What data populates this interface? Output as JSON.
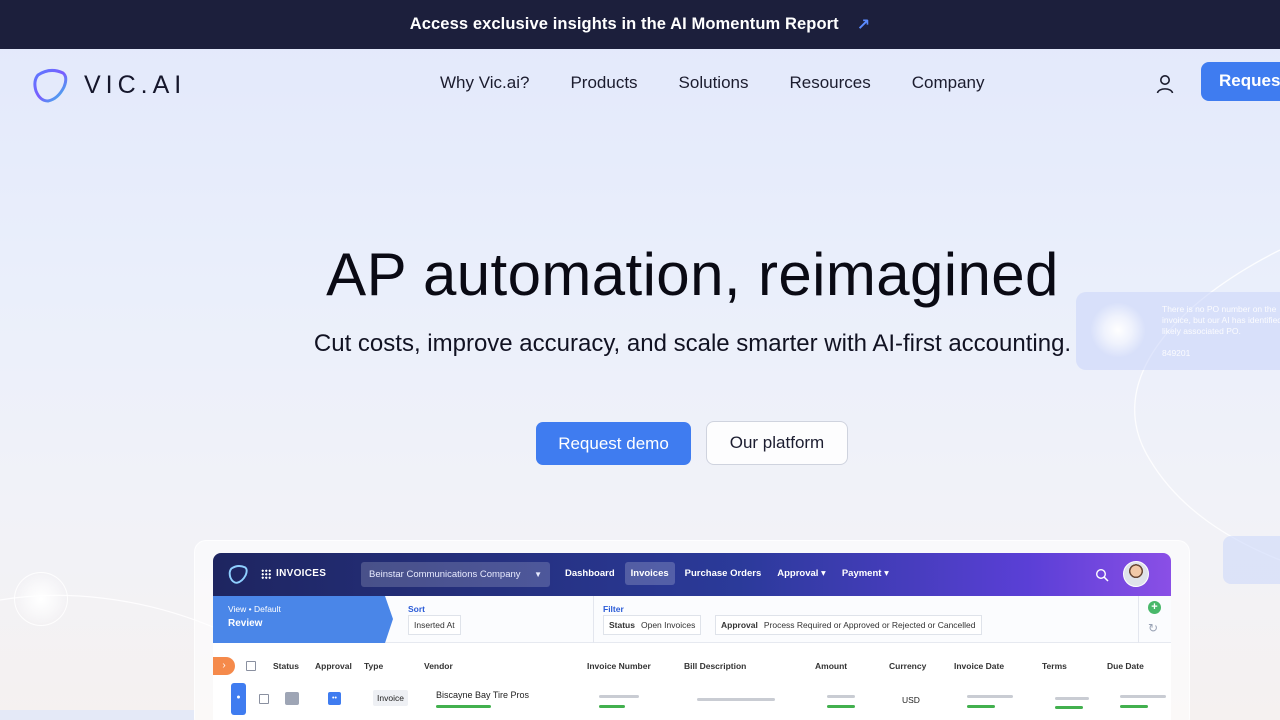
{
  "banner": {
    "text": "Access exclusive insights in the AI Momentum Report",
    "arrow": "↗"
  },
  "nav": {
    "logo_text": "VIC.AI",
    "items": [
      "Why Vic.ai?",
      "Products",
      "Solutions",
      "Resources",
      "Company"
    ],
    "cta_label": "Request demo"
  },
  "hero": {
    "title": "AP automation, reimagined",
    "subtitle": "Cut costs, improve accuracy, and scale smarter with AI-first accounting.",
    "primary_cta": "Request demo",
    "secondary_cta": "Our platform"
  },
  "deco_card": {
    "text": "There is no PO number on the invoice, but our AI has identified a likely associated PO.",
    "number": "849201"
  },
  "app": {
    "title": "INVOICES",
    "company": "Beinstar Communications Company",
    "nav": [
      "Dashboard",
      "Invoices",
      "Purchase Orders",
      "Approval ▾",
      "Payment ▾"
    ],
    "view_label": "View • Default",
    "view_value": "Review",
    "sort_label": "Sort",
    "sort_value": "Inserted At",
    "filter_label": "Filter",
    "filter_status_key": "Status",
    "filter_status_value": "Open Invoices",
    "filter_approval_key": "Approval",
    "filter_approval_value": "Process Required or Approved or Rejected or Cancelled",
    "columns": [
      "Status",
      "Approval",
      "Type",
      "Vendor",
      "Invoice Number",
      "Bill Description",
      "Amount",
      "Currency",
      "Invoice Date",
      "Terms",
      "Due Date"
    ],
    "row": {
      "type": "Invoice",
      "vendor": "Biscayne Bay Tire Pros",
      "currency": "USD"
    }
  },
  "colors": {
    "accent": "#3f7cf0",
    "banner_bg": "#1c1f3c",
    "status_green": "#42b04e"
  }
}
